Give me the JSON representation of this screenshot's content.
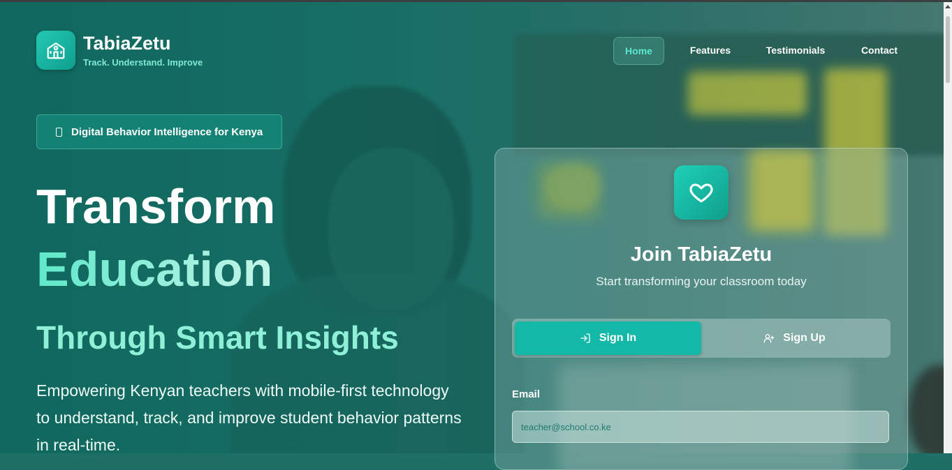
{
  "brand": {
    "name": "TabiaZetu",
    "tagline": "Track. Understand. Improve"
  },
  "nav": {
    "items": [
      {
        "label": "Home",
        "active": true
      },
      {
        "label": "Features",
        "active": false
      },
      {
        "label": "Testimonials",
        "active": false
      },
      {
        "label": "Contact",
        "active": false
      }
    ]
  },
  "hero": {
    "badge": "Digital Behavior Intelligence for Kenya",
    "title_line1": "Transform",
    "title_line2": "Education",
    "subtitle": "Through Smart Insights",
    "description": "Empowering Kenyan teachers with mobile-first technology to understand, track, and improve student behavior patterns in real-time."
  },
  "auth_card": {
    "icon": "heart-icon",
    "title": "Join TabiaZetu",
    "subtitle": "Start transforming your classroom today",
    "tabs": [
      {
        "label": "Sign In",
        "icon": "sign-in-icon",
        "active": true
      },
      {
        "label": "Sign Up",
        "icon": "user-plus-icon",
        "active": false
      }
    ],
    "email_label": "Email",
    "email_placeholder": "teacher@school.co.ke",
    "email_value": ""
  },
  "colors": {
    "accent": "#14b8a6",
    "brand_light": "#5ee8cf",
    "background": "#1f6f66"
  }
}
